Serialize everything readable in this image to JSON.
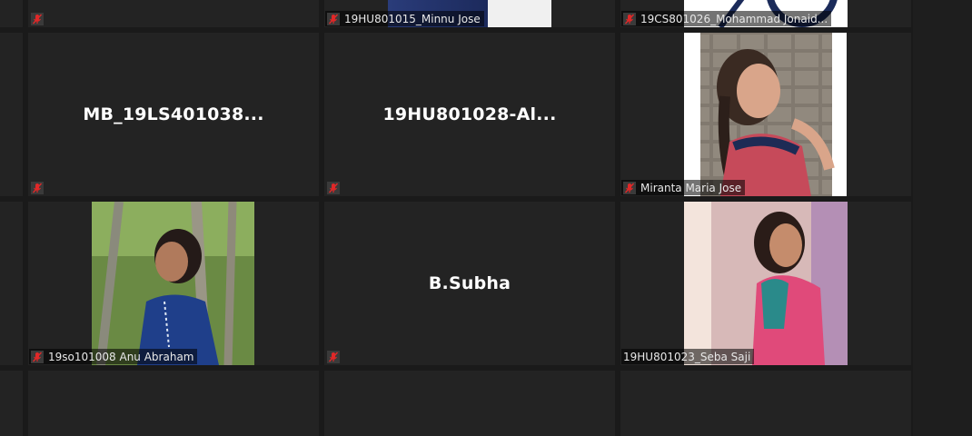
{
  "colors": {
    "background": "#1a1a1a",
    "tile": "#232323",
    "mic_muted": "#e02828",
    "name_text": "#ffffff"
  },
  "icons": {
    "mic": "mic-muted-icon"
  },
  "participants": {
    "minnu": {
      "label": "19HU801015_Minnu Jose"
    },
    "jonaid": {
      "label": "19CS801026_Mohammad Jonaid..."
    },
    "mb": {
      "name": "MB_19LS401038..."
    },
    "al": {
      "name": "19HU801028-Al..."
    },
    "miranta": {
      "label": "Miranta Maria Jose"
    },
    "anu": {
      "label": "19so101008 Anu Abraham"
    },
    "subha": {
      "name": "B.Subha"
    },
    "seba": {
      "label": "19HU801023_Seba Saji"
    }
  }
}
